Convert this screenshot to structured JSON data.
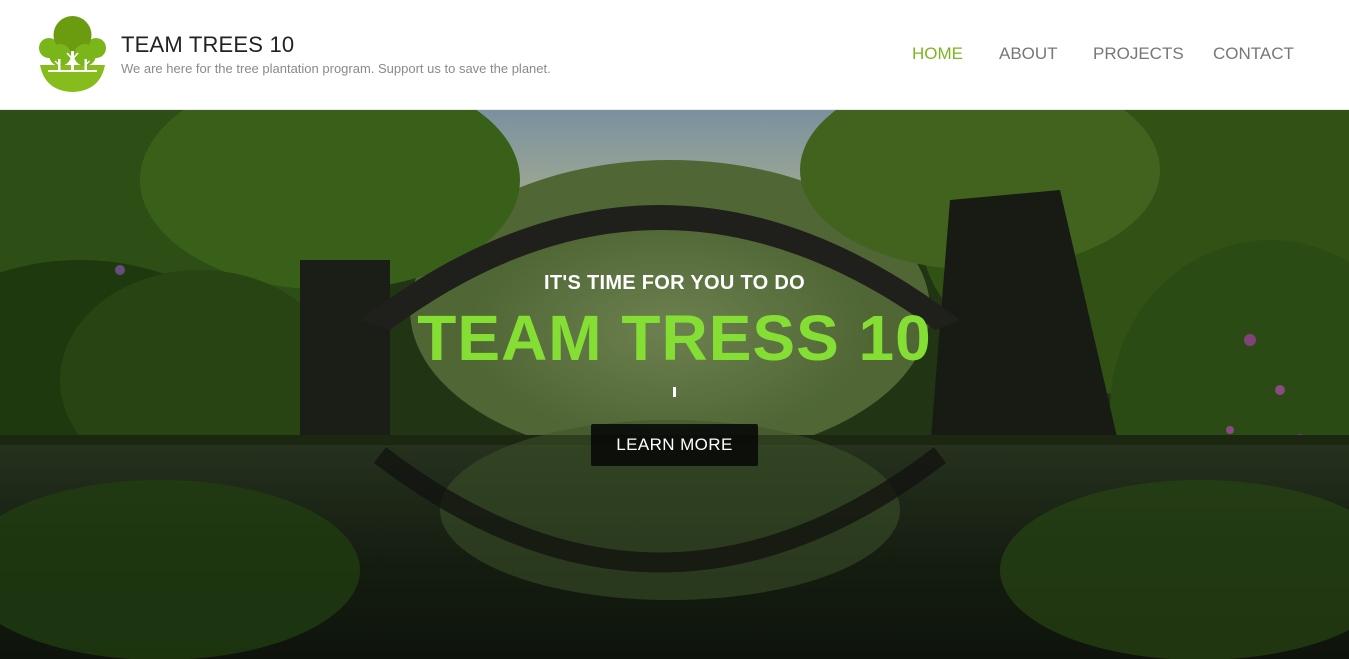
{
  "brand": {
    "title": "TEAM TREES 10",
    "tagline": "We are here for the tree plantation program. Support us to save the planet.",
    "logo_icon": "tree-logo-icon",
    "accent_color": "#7db51e"
  },
  "nav": {
    "items": [
      {
        "label": "HOME",
        "active": true
      },
      {
        "label": "ABOUT",
        "active": false
      },
      {
        "label": "PROJECTS",
        "active": false
      },
      {
        "label": "CONTACT",
        "active": false
      }
    ],
    "active_color": "#7db51e",
    "inactive_color": "#777777"
  },
  "hero": {
    "kicker": "IT'S TIME FOR YOU TO DO",
    "title": "TEAM TRESS 10",
    "title_color": "#84de34",
    "cta_label": "LEARN MORE"
  }
}
